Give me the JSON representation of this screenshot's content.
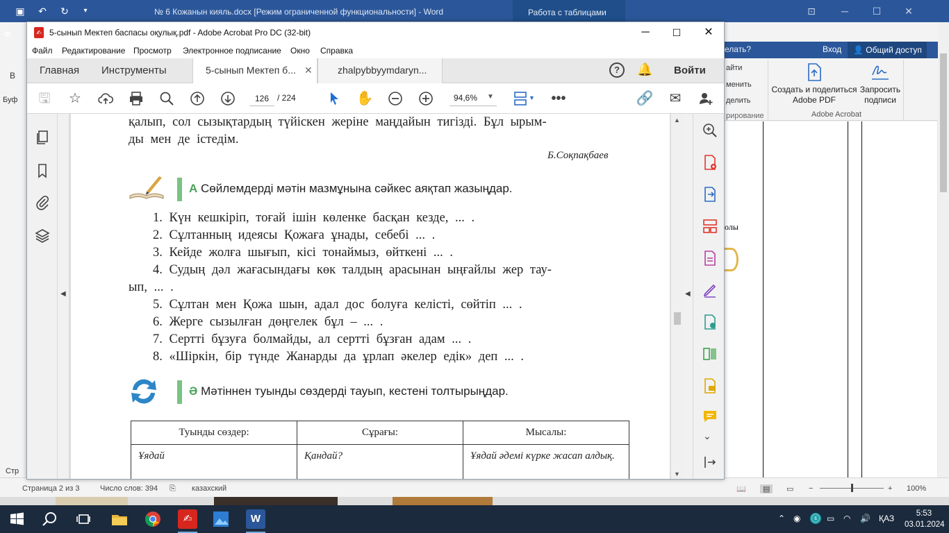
{
  "word": {
    "title": "№ 6 Кожанын кияль.docx [Режим ограниченной функциональности] - Word",
    "context_tab": "Работа с таблицами",
    "left_fragments": [
      "Ф",
      "В",
      "Буф",
      "Стр"
    ],
    "tell_me": "елать?",
    "sign_in": "Вход",
    "share": "Общий доступ",
    "ribbon_small": [
      "айти",
      "менить",
      "делить",
      "рирование"
    ],
    "adobe_create": "Создать и поделиться Adobe PDF",
    "adobe_request": "Запросить подписи",
    "adobe_group": "Adobe Acrobat",
    "page_fragment": "олы",
    "status": {
      "page": "Страница 2 из 3",
      "words": "Число слов: 394",
      "language": "казахский",
      "zoom": "100%"
    }
  },
  "acrobat": {
    "title": "5-сынып Мектеп баспасы оқулық.pdf - Adobe Acrobat Pro DC (32-bit)",
    "menu": [
      "Файл",
      "Редактирование",
      "Просмотр",
      "Электронное подписание",
      "Окно",
      "Справка"
    ],
    "tabs": {
      "home": "Главная",
      "tools": "Инструменты",
      "doc1": "5-сынып Мектеп б...",
      "doc2": "zhalpybbyymdaryn..."
    },
    "signin": "Войти",
    "page_current": "126",
    "page_total": "/  224",
    "zoom": "94,6%"
  },
  "book": {
    "line1": "қалып,  сол  сызықтардың   түйіскен  жеріне  маңдайын  тигізді.  Бұл  ырым-",
    "line2": "ды  мен  де  істедім.",
    "author": "Б.Соқпақбаев",
    "task_a_letter": "А",
    "task_a": "Сөйлемдерді мәтін мазмұнына сәйкес аяқтап жазыңдар.",
    "sentences": [
      "1.  Күн  кешкіріп,    тоғай  ішін  көленке   басқан  кезде,   ...  .",
      "2.  Сұлтанның   идеясы  Қожаға   ұнады,   себебі  ...  .",
      "3.  Кейде  жолға  шығып,   кісі  тонаймыз,    өйткені   ...  .",
      "4.  Судың  дәл  жағасындағы    көк  талдың  арасынан   ыңғайлы   жер  тау-",
      "ып,  ...  .",
      "5.  Сұлтан  мен  Қожа  шын,  адал  дос  болуға  келісті,   сөйтіп  ...  .",
      "6.  Жерге   сызылған   дөңгелек   бұл  –  ...  .",
      "7.  Сертті  бұзуға  болмайды,   ал  сертті  бұзған  адам   ...  .",
      "8.  «Шіркін,    бір  түнде  Жанарды    да  ұрлап   әкелер   едік»   деп  ...  ."
    ],
    "task_b_letter": "Ә",
    "task_b": "Мәтіннен туынды сөздерді тауып, кестені толтырыңдар.",
    "table": {
      "headers": [
        "Туынды   сөздер:",
        "Сұрағы:",
        "Мысалы:"
      ],
      "row": [
        "Ұядай",
        "Қандай?",
        "Ұядай   әдемі  күрке   жасап алдық."
      ]
    }
  },
  "taskbar": {
    "language": "ҚАЗ",
    "time": "5:53",
    "date": "03.01.2024"
  },
  "colors": {
    "word_blue": "#2b579a",
    "acrobat_red": "#d7261e",
    "task_green": "#79c383",
    "taskbar": "#1b2a3d"
  }
}
